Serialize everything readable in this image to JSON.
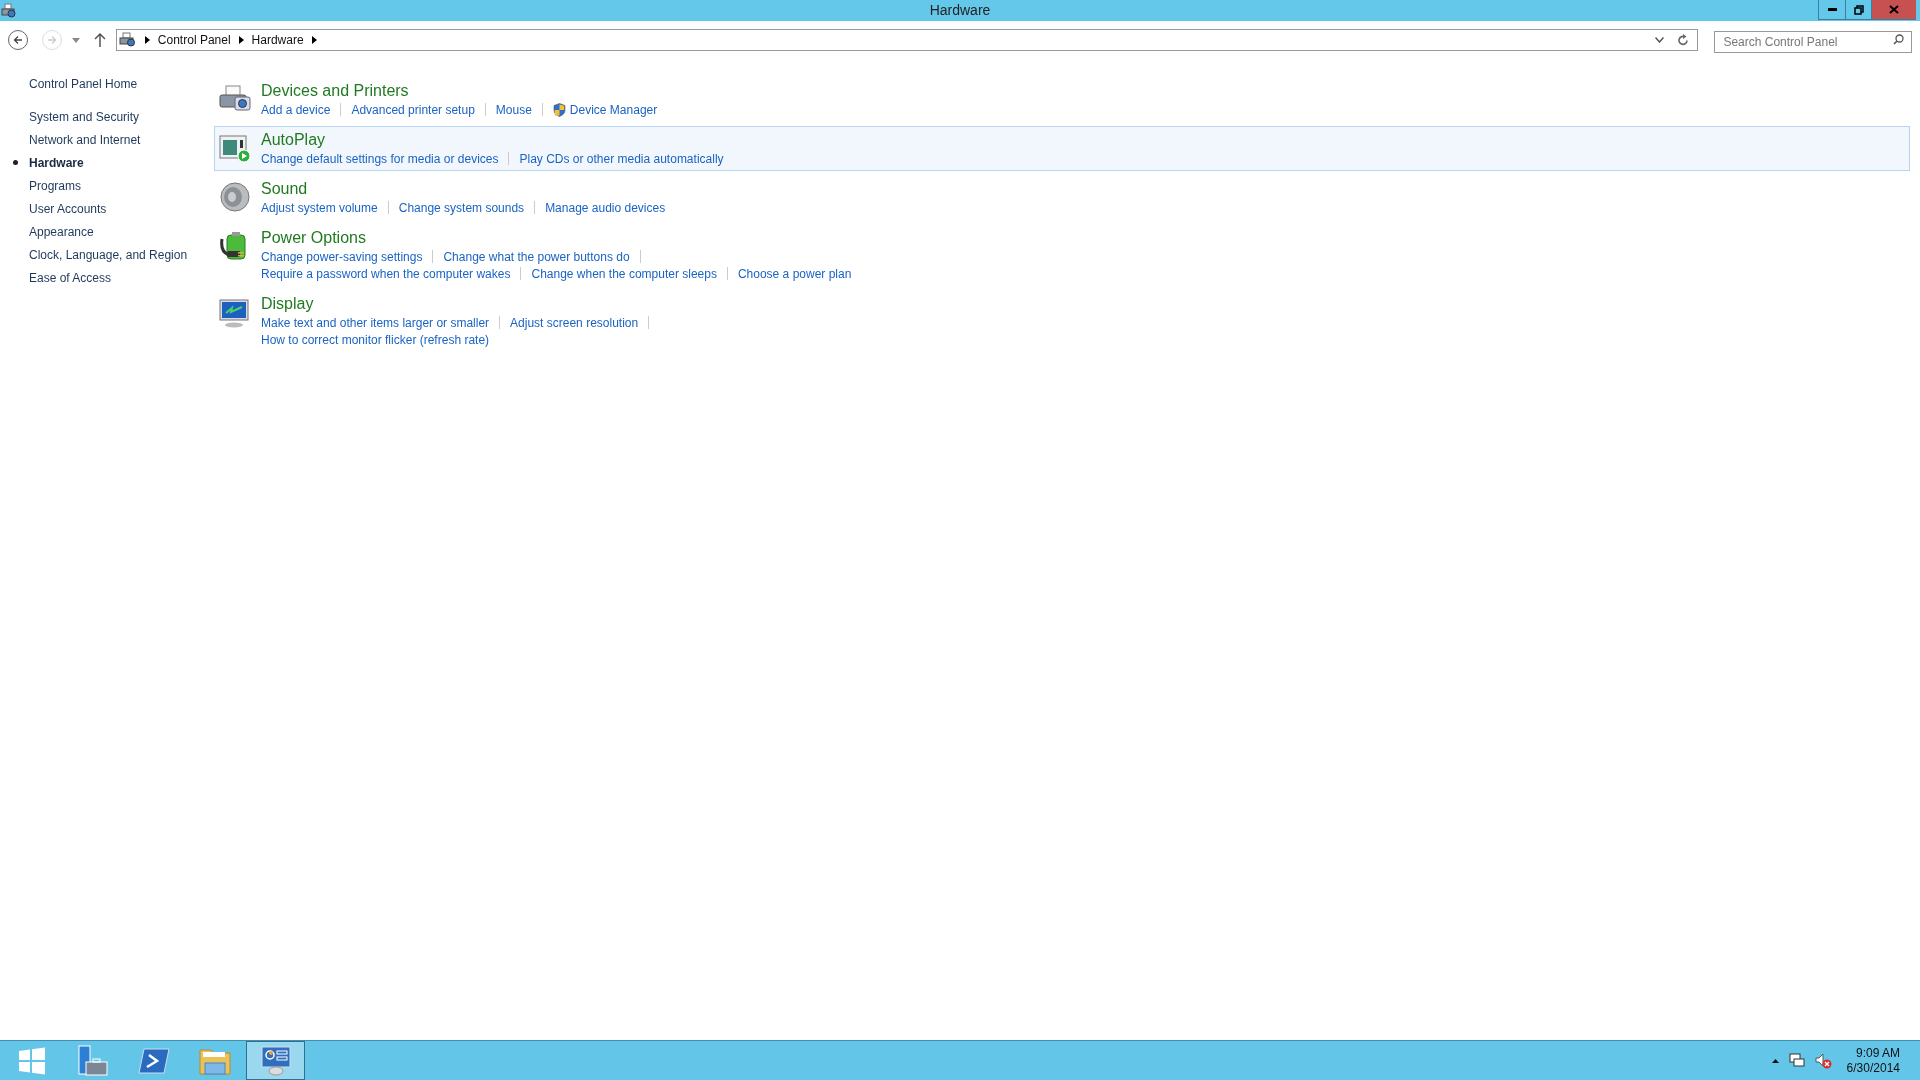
{
  "window": {
    "title": "Hardware"
  },
  "address_bar": {
    "crumbs": [
      "Control Panel",
      "Hardware"
    ]
  },
  "search": {
    "placeholder": "Search Control Panel"
  },
  "sidebar": {
    "items": [
      {
        "label": "Control Panel Home",
        "selected": false,
        "kind": "home"
      },
      {
        "label": "System and Security",
        "selected": false,
        "kind": "category"
      },
      {
        "label": "Network and Internet",
        "selected": false,
        "kind": "category"
      },
      {
        "label": "Hardware",
        "selected": true,
        "kind": "category"
      },
      {
        "label": "Programs",
        "selected": false,
        "kind": "category"
      },
      {
        "label": "User Accounts",
        "selected": false,
        "kind": "category"
      },
      {
        "label": "Appearance",
        "selected": false,
        "kind": "category"
      },
      {
        "label": "Clock, Language, and Region",
        "selected": false,
        "kind": "category"
      },
      {
        "label": "Ease of Access",
        "selected": false,
        "kind": "category"
      }
    ]
  },
  "sections": [
    {
      "kind": "printer",
      "title": "Devices and Printers",
      "selected": false,
      "lines": [
        [
          {
            "label": "Add a device",
            "kind": "link"
          },
          {
            "label": "Advanced printer setup",
            "kind": "link"
          },
          {
            "label": "Mouse",
            "kind": "link"
          },
          {
            "label": "Device Manager",
            "kind": "shield"
          }
        ]
      ]
    },
    {
      "kind": "autoplay",
      "title": "AutoPlay",
      "selected": true,
      "lines": [
        [
          {
            "label": "Change default settings for media or devices",
            "kind": "link"
          },
          {
            "label": "Play CDs or other media automatically",
            "kind": "link"
          }
        ]
      ]
    },
    {
      "kind": "sound",
      "title": "Sound",
      "selected": false,
      "lines": [
        [
          {
            "label": "Adjust system volume",
            "kind": "link"
          },
          {
            "label": "Change system sounds",
            "kind": "link"
          },
          {
            "label": "Manage audio devices",
            "kind": "link"
          }
        ]
      ]
    },
    {
      "kind": "power",
      "title": "Power Options",
      "selected": false,
      "lines": [
        [
          {
            "label": "Change power-saving settings",
            "kind": "link"
          },
          {
            "label": "Change what the power buttons do",
            "kind": "link"
          }
        ],
        [
          {
            "label": "Require a password when the computer wakes",
            "kind": "link"
          },
          {
            "label": "Change when the computer sleeps",
            "kind": "link"
          },
          {
            "label": "Choose a power plan",
            "kind": "link"
          }
        ]
      ]
    },
    {
      "kind": "display",
      "title": "Display",
      "selected": false,
      "lines": [
        [
          {
            "label": "Make text and other items larger or smaller",
            "kind": "link"
          },
          {
            "label": "Adjust screen resolution",
            "kind": "link"
          }
        ],
        [
          {
            "label": "How to correct monitor flicker (refresh rate)",
            "kind": "link"
          }
        ]
      ]
    }
  ],
  "taskbar": {
    "apps": [
      {
        "kind": "start",
        "selected": false
      },
      {
        "kind": "server",
        "selected": false
      },
      {
        "kind": "shell",
        "selected": false
      },
      {
        "kind": "folder",
        "selected": false
      },
      {
        "kind": "control",
        "selected": true
      }
    ],
    "tray": {
      "time": "9:09 AM",
      "date": "6/30/2014"
    }
  }
}
